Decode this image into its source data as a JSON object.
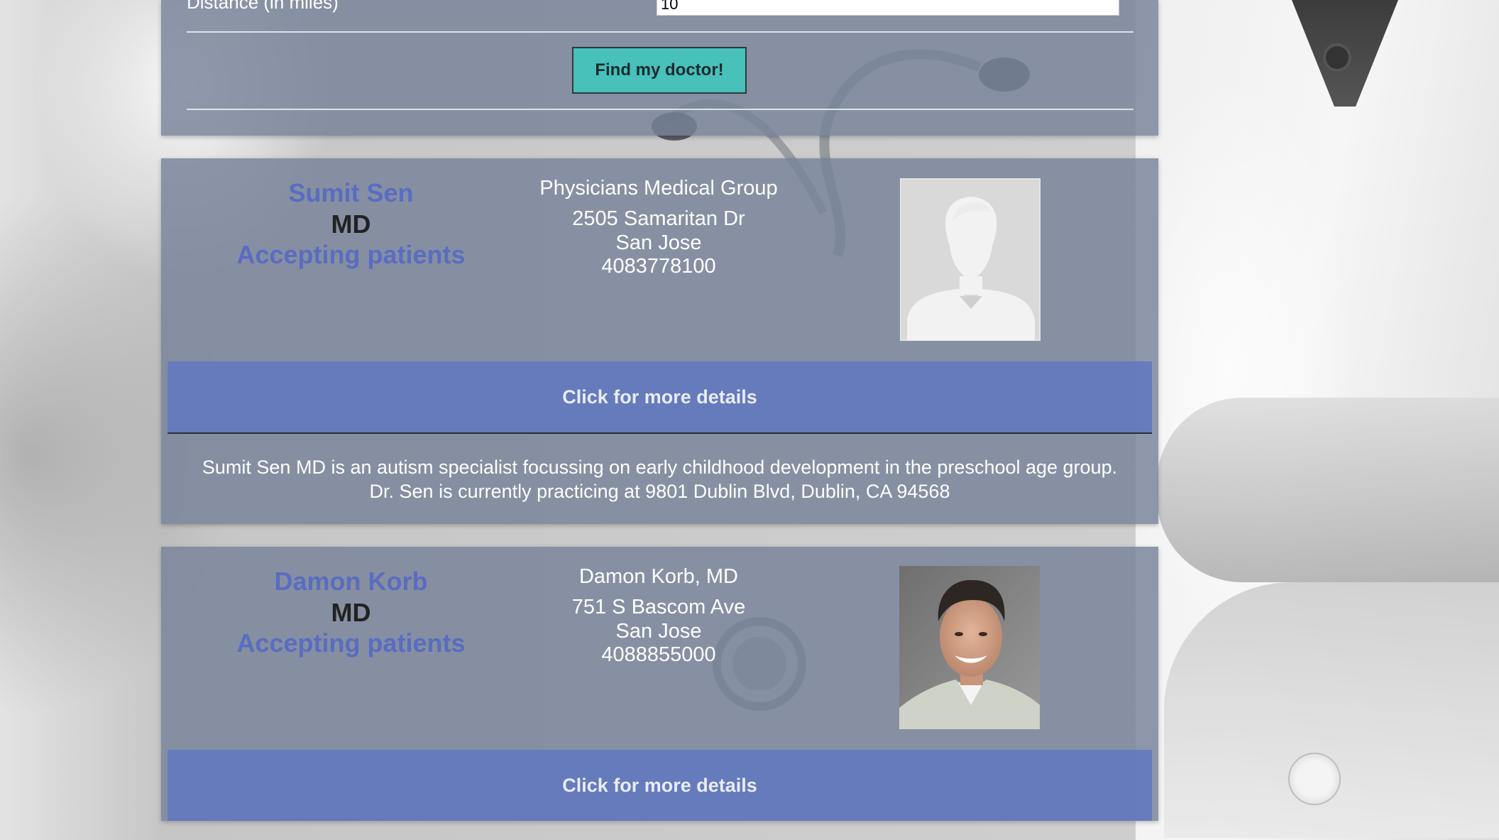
{
  "search": {
    "distance_label": "Distance (in miles)",
    "distance_value": "10",
    "find_button_label": "Find my doctor!"
  },
  "doctors": [
    {
      "name": "Sumit Sen",
      "credential": "MD",
      "status": "Accepting patients",
      "group": "Physicians Medical Group",
      "address": "2505 Samaritan Dr",
      "city": "San Jose",
      "phone": "4083778100",
      "photo": "placeholder-avatar",
      "details_label": "Click for more details",
      "description": "Sumit Sen MD is an autism specialist focussing on early childhood development in the preschool age group. Dr. Sen is currently practicing at 9801 Dublin Blvd, Dublin, CA 94568"
    },
    {
      "name": "Damon Korb",
      "credential": "MD",
      "status": "Accepting patients",
      "group": "Damon Korb, MD",
      "address": "751 S Bascom Ave",
      "city": "San Jose",
      "phone": "4088855000",
      "photo": "doctor-portrait",
      "details_label": "Click for more details"
    }
  ],
  "colors": {
    "name_text": "#5a6cc1",
    "details_bar": "#637abe",
    "find_button": "#47c1ba",
    "panel": "#768398"
  }
}
